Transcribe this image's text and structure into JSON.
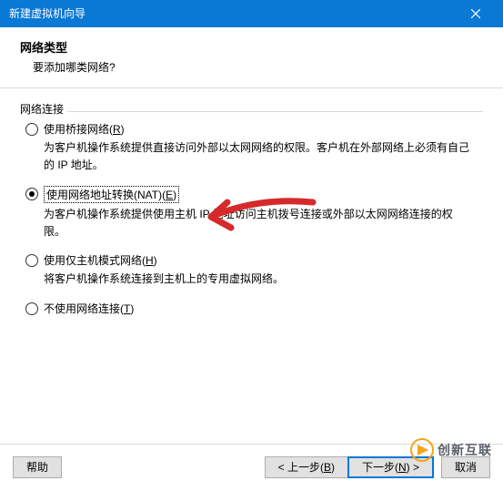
{
  "titlebar": {
    "title": "新建虚拟机向导",
    "close_icon": "close-icon"
  },
  "header": {
    "title": "网络类型",
    "subtitle": "要添加哪类网络?"
  },
  "group": {
    "label": "网络连接"
  },
  "options": {
    "bridged": {
      "label_prefix": "使用桥接网络(",
      "mnemonic": "R",
      "label_suffix": ")",
      "desc": "为客户机操作系统提供直接访问外部以太网网络的权限。客户机在外部网络上必须有自己的 IP 地址。"
    },
    "nat": {
      "label_prefix": "使用网络地址转换(NAT)(",
      "mnemonic": "E",
      "label_suffix": ")",
      "desc": "为客户机操作系统提供使用主机 IP 地址访问主机拨号连接或外部以太网网络连接的权限。"
    },
    "hostonly": {
      "label_prefix": "使用仅主机模式网络(",
      "mnemonic": "H",
      "label_suffix": ")",
      "desc": "将客户机操作系统连接到主机上的专用虚拟网络。"
    },
    "none": {
      "label_prefix": "不使用网络连接(",
      "mnemonic": "T",
      "label_suffix": ")"
    }
  },
  "buttons": {
    "help": "帮助",
    "back_prefix": "< 上一步(",
    "back_mnemonic": "B",
    "back_suffix": ")",
    "next_prefix": "下一步(",
    "next_mnemonic": "N",
    "next_suffix": ") >",
    "cancel": "取消"
  },
  "annotation": {
    "arrow_color": "#d62a2a"
  },
  "logo": {
    "text": "创新互联"
  }
}
